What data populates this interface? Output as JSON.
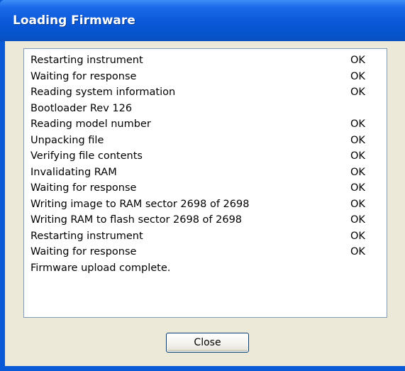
{
  "window": {
    "title": "Loading Firmware"
  },
  "log": {
    "rows": [
      {
        "message": "Restarting instrument",
        "status": "OK"
      },
      {
        "message": "Waiting for response",
        "status": "OK"
      },
      {
        "message": "Reading system information",
        "status": "OK"
      },
      {
        "message": "Bootloader Rev 126",
        "status": ""
      },
      {
        "message": "Reading model number",
        "status": "OK"
      },
      {
        "message": "Unpacking file",
        "status": "OK"
      },
      {
        "message": "Verifying file contents",
        "status": "OK"
      },
      {
        "message": "Invalidating RAM",
        "status": "OK"
      },
      {
        "message": "Waiting for response",
        "status": "OK"
      },
      {
        "message": "Writing image to RAM sector 2698 of 2698",
        "status": "OK"
      },
      {
        "message": "Writing RAM to flash sector 2698 of 2698",
        "status": "OK"
      },
      {
        "message": "Restarting instrument",
        "status": "OK"
      },
      {
        "message": "Waiting for response",
        "status": "OK"
      },
      {
        "message": "Firmware upload complete.",
        "status": ""
      }
    ]
  },
  "buttons": {
    "close_label": "Close"
  }
}
